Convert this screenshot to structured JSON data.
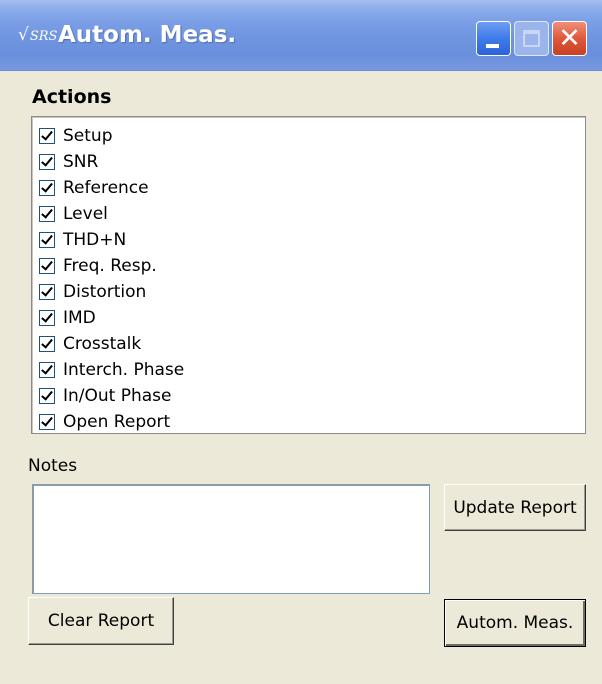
{
  "window": {
    "title": "Autom. Meas.",
    "app_icon_text": "SRS",
    "buttons": {
      "minimize": "minimize",
      "maximize": "maximize",
      "close": "✕"
    }
  },
  "actions": {
    "label": "Actions",
    "items": [
      {
        "label": "Setup",
        "checked": true
      },
      {
        "label": "SNR",
        "checked": true
      },
      {
        "label": "Reference",
        "checked": true
      },
      {
        "label": "Level",
        "checked": true
      },
      {
        "label": "THD+N",
        "checked": true
      },
      {
        "label": "Freq. Resp.",
        "checked": true
      },
      {
        "label": "Distortion",
        "checked": true
      },
      {
        "label": "IMD",
        "checked": true
      },
      {
        "label": "Crosstalk",
        "checked": true
      },
      {
        "label": "Interch. Phase",
        "checked": true
      },
      {
        "label": "In/Out Phase",
        "checked": true
      },
      {
        "label": "Open Report",
        "checked": true
      }
    ]
  },
  "notes": {
    "label": "Notes",
    "value": ""
  },
  "buttons": {
    "update_report": "Update Report",
    "clear_report": "Clear Report",
    "autom_meas": "Autom. Meas."
  },
  "colors": {
    "titlebar": "#6f94e0",
    "window_bg": "#ece9d8",
    "close_button": "#e0583c",
    "minimize_button": "#3f7be8"
  }
}
